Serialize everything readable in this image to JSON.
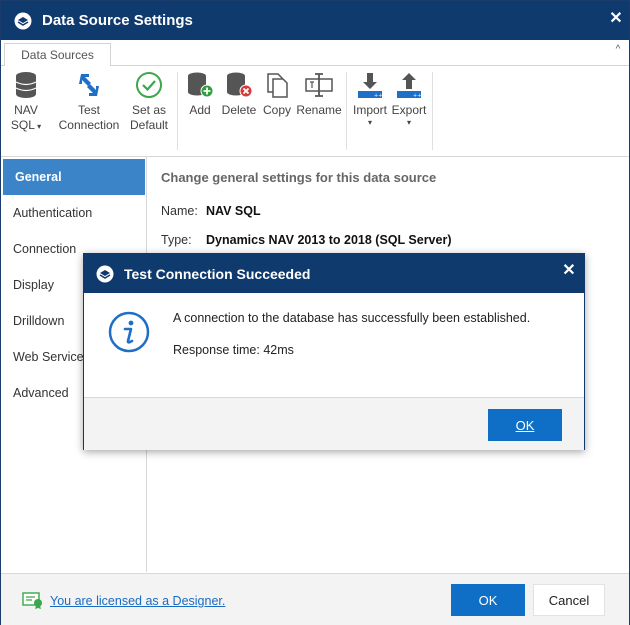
{
  "window": {
    "title": "Data Source Settings",
    "close_icon": "✕"
  },
  "ribbon": {
    "tab": "Data Sources",
    "collapse_icon": "^",
    "buttons": {
      "nav_sql_line1": "NAV",
      "nav_sql_line2": "SQL",
      "test_line1": "Test",
      "test_line2": "Connection",
      "default_line1": "Set as",
      "default_line2": "Default",
      "add": "Add",
      "delete": "Delete",
      "copy": "Copy",
      "rename": "Rename",
      "import": "Import",
      "export": "Export"
    }
  },
  "nav": {
    "items": [
      "General",
      "Authentication",
      "Connection",
      "Display",
      "Drilldown",
      "Web Service",
      "Advanced"
    ],
    "selected": "General"
  },
  "content": {
    "heading": "Change general settings for this data source",
    "name_label": "Name:",
    "name_value": "NAV SQL",
    "type_label": "Type:",
    "type_value": "Dynamics NAV 2013 to 2018 (SQL Server)"
  },
  "footer": {
    "license_text": "You are licensed as a Designer.",
    "ok": "OK",
    "cancel": "Cancel"
  },
  "dialog": {
    "title": "Test Connection Succeeded",
    "close_icon": "✕",
    "message": "A connection to the database has successfully been established.",
    "response": "Response time: 42ms",
    "ok": "OK"
  },
  "colors": {
    "titlebar": "#0f3a6e",
    "accent": "#0f6fc6",
    "nav_selected": "#3b84c8",
    "link": "#1a6cc2"
  }
}
